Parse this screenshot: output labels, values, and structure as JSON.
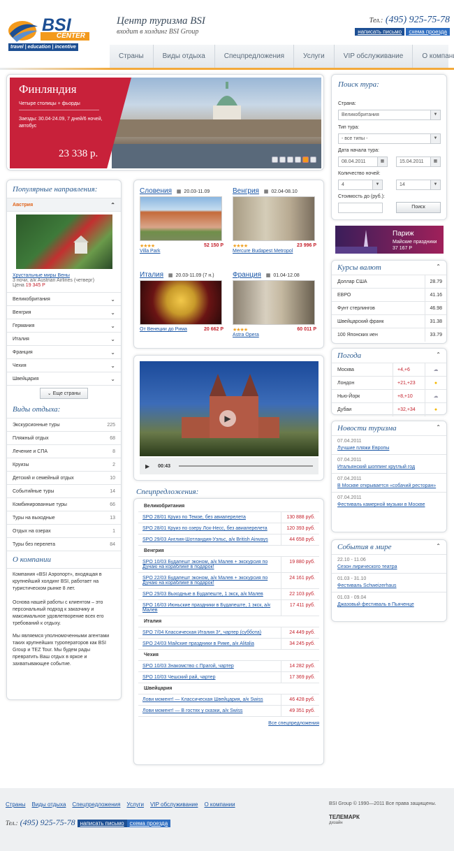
{
  "header": {
    "logo_main": "BSI",
    "logo_sub": "CENTER",
    "logo_tag": [
      "travel",
      "education",
      "incentive"
    ],
    "slogan_title": "Центр туризма BSI",
    "slogan_sub": "входит в холдинг BSI Group",
    "phone_prefix": "Тел.:",
    "phone": "(495) 925-75-78",
    "btn_write": "написать письмо",
    "btn_map": "схема проезда"
  },
  "nav": [
    "Страны",
    "Виды отдыха",
    "Спецпредложения",
    "Услуги",
    "VIP обслуживание",
    "О компании"
  ],
  "hero": {
    "title": "Финляндия",
    "subtitle": "Четыре столицы + фьорды",
    "desc": "Заезды: 30.04-24.09, 7 дней/6 ночей, автобус",
    "price": "23 338 р.",
    "slides": 6,
    "active_slide": 5
  },
  "popular": {
    "title": "Популярные направления:",
    "open": "Австрия",
    "card_link": "Хрустальные миры Вены",
    "card_desc": "3 ночи, а/к Austrian Airlines (четверг)",
    "price_label": "Цена",
    "price": "19 345 Р",
    "items": [
      "Великобритания",
      "Венгрия",
      "Германия",
      "Италия",
      "Франция",
      "Чехия",
      "Швейцария"
    ],
    "more": "Еще страны"
  },
  "kinds": {
    "title": "Виды отдыха:",
    "items": [
      {
        "n": "Экскурсионные туры",
        "c": "225"
      },
      {
        "n": "Пляжный отдых",
        "c": "68"
      },
      {
        "n": "Лечение и СПА",
        "c": "8"
      },
      {
        "n": "Круизы",
        "c": "2"
      },
      {
        "n": "Детский и семейный отдых",
        "c": "10"
      },
      {
        "n": "Событийные туры",
        "c": "14"
      },
      {
        "n": "Комбинированные туры",
        "c": "66"
      },
      {
        "n": "Туры на выходные",
        "c": "13"
      },
      {
        "n": "Отдых на озерах",
        "c": "1"
      },
      {
        "n": "Туры без перелета",
        "c": "84"
      }
    ]
  },
  "about": {
    "title": "О компании",
    "p1": "Компания «BSI Аэропорт», входящая в крупнейший холдинг BSI, работает на туристическом рынке 8 лет.",
    "p2": "Основа нашей работы с клиентом – это персональный подход к заказчику и максимальное удовлетворение всех его требований к отдыху.",
    "p3": "Мы являемся уполномоченными агентами таких крупнейших туроператоров как BSI Group и TEZ Tour. Мы будем рады превратить Ваш отдых в яркое и захватывающее событие."
  },
  "destinations": [
    {
      "country": "Словения",
      "dates": "20.03-11.09",
      "price": "52 150 Р",
      "hotel": "Villa Park"
    },
    {
      "country": "Венгрия",
      "dates": "02.04-08.10",
      "price": "23 996 Р",
      "hotel": "Mercure Budapest Metropol"
    },
    {
      "country": "Италия",
      "dates": "20.03-11.09 (7 н.)",
      "price": "20 662 Р",
      "hotel": "От Венеции до Рима"
    },
    {
      "country": "Франция",
      "dates": "01.04-12.08",
      "price": "60 011 Р",
      "hotel": "Astra Opera"
    }
  ],
  "video": {
    "time": "00:43"
  },
  "special": {
    "title": "Спецпредложения:",
    "groups": [
      {
        "country": "Великобритания",
        "rows": [
          {
            "n": "SPO 28/01 Круиз по Темзе, без авиаперелета",
            "p": "130 888 руб."
          },
          {
            "n": "SPO 28/01 Круиз по озеру Лох-Несс, без авиаперелета",
            "p": "120 393 руб."
          },
          {
            "n": "SPO 29/03 Англия-Шотландия-Уэльс, а/к British Airways",
            "p": "44 658 руб."
          }
        ]
      },
      {
        "country": "Венгрия",
        "rows": [
          {
            "n": "SPO 10/03 Будапешт эконом, а/к Малев + экскурсия по Дунаю на кораблике в подарок!",
            "p": "19 880 руб."
          },
          {
            "n": "SPO 22/03 Будапешт эконом, а/к Малев + экскурсия по Дунаю на кораблике в подарок!",
            "p": "24 161 руб."
          },
          {
            "n": "SPO 29/03 Выходные в Будапеште, 1 экск, а/к Малев",
            "p": "22 103 руб."
          },
          {
            "n": "SPO 16/03 Июньские праздники в Будапеште, 1 экск, а/к Малев",
            "p": "17 411 руб."
          }
        ]
      },
      {
        "country": "Италия",
        "rows": [
          {
            "n": "SPO 7/04 Классическая Италия 3*, чартер (суббота)",
            "p": "24 449 руб."
          },
          {
            "n": "SPO 24/03 Майские праздники в Риме, а/к Alitalia",
            "p": "34 245 руб."
          }
        ]
      },
      {
        "country": "Чехия",
        "rows": [
          {
            "n": "SPO 10/03 Знакомство с Прагой, чартер",
            "p": "14 282 руб."
          },
          {
            "n": "SPO 10/03 Чешский рай, чартер",
            "p": "17 369 руб."
          }
        ]
      },
      {
        "country": "Швейцария",
        "rows": [
          {
            "n": "Лови момент! — Классическая Швейцария, а/к Swiss",
            "p": "46 428 руб."
          },
          {
            "n": "Лови момент! — В гостях у сказки, а/к Swiss",
            "p": "49 351 руб."
          }
        ]
      }
    ],
    "all": "Все спецпредложения"
  },
  "search": {
    "title": "Поиск тура:",
    "country_label": "Страна:",
    "country": "Великобритания",
    "type_label": "Тип тура:",
    "type": "- все типы -",
    "date_label": "Дата начала тура:",
    "date_from": "08.04.2011",
    "date_to": "15.04.2011",
    "nights_label": "Количество ночей:",
    "nights_from": "4",
    "nights_to": "14",
    "cost_label": "Стоимость до (руб.):",
    "btn": "Поиск"
  },
  "promo": {
    "city": "Париж",
    "text": "Майские праздники",
    "price": "37 167 Р"
  },
  "currency": {
    "title": "Курсы валют",
    "rows": [
      {
        "n": "Доллар США",
        "v": "28.79"
      },
      {
        "n": "ЕВРО",
        "v": "41.16"
      },
      {
        "n": "Фунт стерлингов",
        "v": "46.98"
      },
      {
        "n": "Швейцарский франк",
        "v": "31.38"
      },
      {
        "n": "100 Японских иен",
        "v": "33.79"
      }
    ]
  },
  "weather": {
    "title": "Погода",
    "rows": [
      {
        "c": "Москва",
        "t": "+4,+6",
        "i": "cloud"
      },
      {
        "c": "Лондон",
        "t": "+21,+23",
        "i": "sun"
      },
      {
        "c": "Нью-Йорк",
        "t": "+8,+10",
        "i": "cloud"
      },
      {
        "c": "Дубаи",
        "t": "+32,+34",
        "i": "sun"
      }
    ]
  },
  "news": {
    "title": "Новости туризма",
    "items": [
      {
        "d": "07.04.2011",
        "t": "Лучшие пляжи Европы"
      },
      {
        "d": "07.04.2011",
        "t": "Итальянский шоппинг круглый год"
      },
      {
        "d": "07.04.2011",
        "t": "В Москве открывается «собачий ресторан»"
      },
      {
        "d": "07.04.2011",
        "t": "Фестиваль камерной музыки в Москве"
      }
    ]
  },
  "events": {
    "title": "События в мире",
    "items": [
      {
        "d": "22.10 - 11.06",
        "t": "Сезон лирического театра"
      },
      {
        "d": "01.03 - 31.10",
        "t": "Фестиваль Schweizerhaus"
      },
      {
        "d": "01.03 - 09.04",
        "t": "Джазовый фестиваль в Пьяченце"
      }
    ]
  },
  "footer": {
    "copy": "BSI Group © 1990—2011 Все права защищены.",
    "studio": "ТЕЛЕМАРК",
    "studio_sub": "дизайн"
  },
  "colors": {
    "accent": "#c8213a",
    "link": "#1a56a6",
    "navy": "#1d4f93"
  }
}
